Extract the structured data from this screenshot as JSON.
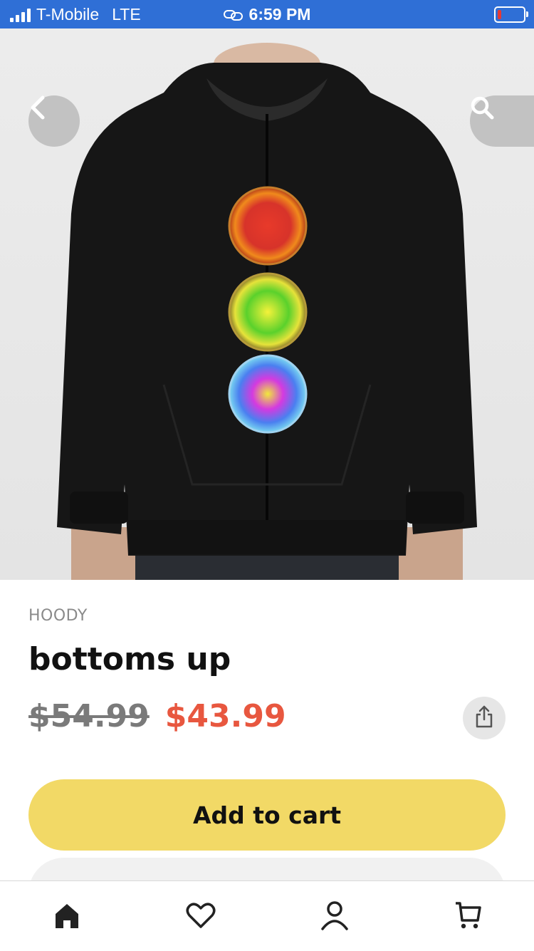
{
  "status_bar": {
    "carrier": "T-Mobile",
    "network": "LTE",
    "time": "6:59 PM",
    "battery_color": "#e53935"
  },
  "header": {
    "back_icon": "chevron-left-icon",
    "search_icon": "search-icon"
  },
  "product": {
    "category": "HOODY",
    "title": "bottoms up",
    "original_price": "$54.99",
    "sale_price": "$43.99",
    "share_icon": "share-icon",
    "sale_color": "#e8573f"
  },
  "actions": {
    "add_to_cart_label": "Add to cart",
    "button_color": "#f2d966"
  },
  "tab_bar": {
    "items": [
      "home-icon",
      "heart-icon",
      "account-icon",
      "cart-icon"
    ]
  }
}
